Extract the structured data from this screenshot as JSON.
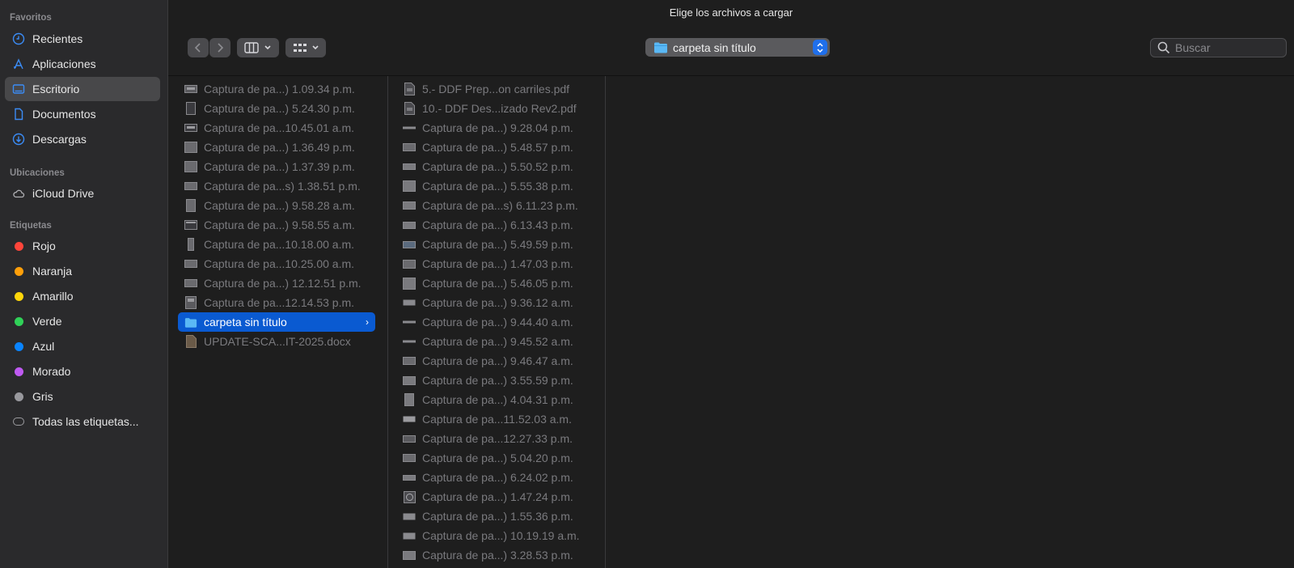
{
  "dialog": {
    "title": "Elige los archivos a cargar"
  },
  "sidebar": {
    "favorites_header": "Favoritos",
    "favorites": [
      {
        "label": "Recientes",
        "icon": "clock-icon"
      },
      {
        "label": "Aplicaciones",
        "icon": "apps-icon"
      },
      {
        "label": "Escritorio",
        "icon": "desktop-icon",
        "selected": true
      },
      {
        "label": "Documentos",
        "icon": "document-icon"
      },
      {
        "label": "Descargas",
        "icon": "download-icon"
      }
    ],
    "locations_header": "Ubicaciones",
    "locations": [
      {
        "label": "iCloud Drive",
        "icon": "cloud-icon"
      }
    ],
    "tags_header": "Etiquetas",
    "tags": [
      {
        "label": "Rojo",
        "color": "#ff453a"
      },
      {
        "label": "Naranja",
        "color": "#ff9f0a"
      },
      {
        "label": "Amarillo",
        "color": "#ffd60a"
      },
      {
        "label": "Verde",
        "color": "#30d158"
      },
      {
        "label": "Azul",
        "color": "#0a84ff"
      },
      {
        "label": "Morado",
        "color": "#bf5af2"
      },
      {
        "label": "Gris",
        "color": "#98989d"
      }
    ],
    "all_tags": "Todas las etiquetas..."
  },
  "toolbar": {
    "current_folder": "carpeta sin título",
    "search_placeholder": "Buscar"
  },
  "column1": [
    {
      "name": "Captura de pa...) 1.09.34 p.m.",
      "kind": "image"
    },
    {
      "name": "Captura de pa...) 5.24.30 p.m.",
      "kind": "image"
    },
    {
      "name": "Captura de pa...10.45.01 a.m.",
      "kind": "image"
    },
    {
      "name": "Captura de pa...) 1.36.49 p.m.",
      "kind": "image"
    },
    {
      "name": "Captura de pa...) 1.37.39 p.m.",
      "kind": "image"
    },
    {
      "name": "Captura de pa...s) 1.38.51 p.m.",
      "kind": "image"
    },
    {
      "name": "Captura de pa...) 9.58.28 a.m.",
      "kind": "image"
    },
    {
      "name": "Captura de pa...) 9.58.55 a.m.",
      "kind": "image"
    },
    {
      "name": "Captura de pa...10.18.00 a.m.",
      "kind": "image"
    },
    {
      "name": "Captura de pa...10.25.00 a.m.",
      "kind": "image"
    },
    {
      "name": "Captura de pa...) 12.12.51 p.m.",
      "kind": "image"
    },
    {
      "name": "Captura de pa...12.14.53 p.m.",
      "kind": "image"
    },
    {
      "name": "carpeta sin título",
      "kind": "folder",
      "selected": true
    },
    {
      "name": "UPDATE-SCA...IT-2025.docx",
      "kind": "docx"
    }
  ],
  "column2": [
    {
      "name": "5.- DDF Prep...on carriles.pdf",
      "kind": "pdf"
    },
    {
      "name": "10.- DDF Des...izado Rev2.pdf",
      "kind": "pdf"
    },
    {
      "name": "Captura de pa...) 9.28.04 p.m.",
      "kind": "image"
    },
    {
      "name": "Captura de pa...) 5.48.57 p.m.",
      "kind": "image"
    },
    {
      "name": "Captura de pa...) 5.50.52 p.m.",
      "kind": "image"
    },
    {
      "name": "Captura de pa...) 5.55.38 p.m.",
      "kind": "image"
    },
    {
      "name": "Captura de pa...s) 6.11.23 p.m.",
      "kind": "image"
    },
    {
      "name": "Captura de pa...) 6.13.43 p.m.",
      "kind": "image"
    },
    {
      "name": "Captura de pa...) 5.49.59 p.m.",
      "kind": "image"
    },
    {
      "name": "Captura de pa...) 1.47.03 p.m.",
      "kind": "image"
    },
    {
      "name": "Captura de pa...) 5.46.05 p.m.",
      "kind": "image"
    },
    {
      "name": "Captura de pa...) 9.36.12 a.m.",
      "kind": "image"
    },
    {
      "name": "Captura de pa...) 9.44.40 a.m.",
      "kind": "image"
    },
    {
      "name": "Captura de pa...) 9.45.52 a.m.",
      "kind": "image"
    },
    {
      "name": "Captura de pa...) 9.46.47 a.m.",
      "kind": "image"
    },
    {
      "name": "Captura de pa...) 3.55.59 p.m.",
      "kind": "image"
    },
    {
      "name": "Captura de pa...) 4.04.31 p.m.",
      "kind": "image"
    },
    {
      "name": "Captura de pa...11.52.03 a.m.",
      "kind": "image"
    },
    {
      "name": "Captura de pa...12.27.33 p.m.",
      "kind": "image"
    },
    {
      "name": "Captura de pa...) 5.04.20 p.m.",
      "kind": "image"
    },
    {
      "name": "Captura de pa...) 6.24.02 p.m.",
      "kind": "image"
    },
    {
      "name": "Captura de pa...) 1.47.24 p.m.",
      "kind": "image"
    },
    {
      "name": "Captura de pa...) 1.55.36 p.m.",
      "kind": "image"
    },
    {
      "name": "Captura de pa...) 10.19.19 a.m.",
      "kind": "image"
    },
    {
      "name": "Captura de pa...) 3.28.53 p.m.",
      "kind": "image"
    }
  ]
}
